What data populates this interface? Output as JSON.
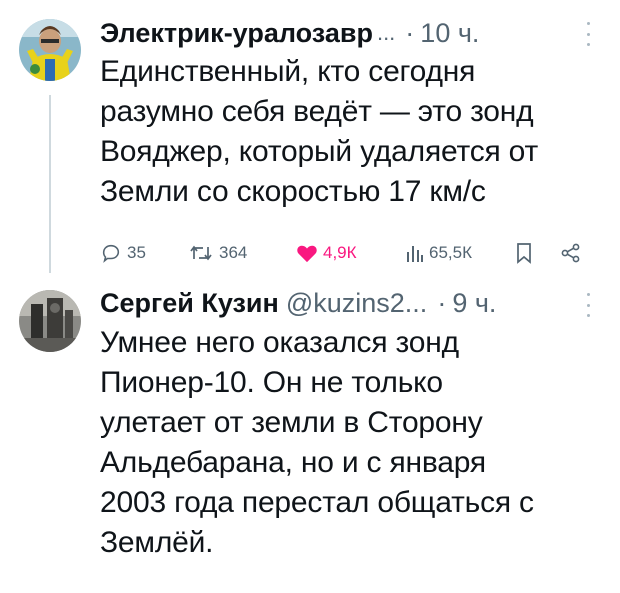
{
  "tweet1": {
    "author": "Электрик-уралозавр",
    "ellipsis": "...",
    "separator": "·",
    "time": "10 ч.",
    "text": "Единственный, кто сегодня\nразумно себя ведёт — это зонд\nВояджер, который удаляется от\nЗемли со скоростью 17 км/с",
    "actions": {
      "replies": "35",
      "retweets": "364",
      "likes": "4,9К",
      "views": "65,5К"
    }
  },
  "tweet2": {
    "author": "Сергей Кузин",
    "handle": "@kuzins2...",
    "separator": "·",
    "time": "9 ч.",
    "text": "Умнее него оказался зонд\nПионер-10. Он не только\nулетает от земли в Сторону\nАльдебарана,  но и с января\n2003 года перестал общаться с\nЗемлёй."
  },
  "colors": {
    "like": "#f91880",
    "muted": "#536471",
    "text": "#0f1419",
    "thread_line": "#cfd9de"
  }
}
